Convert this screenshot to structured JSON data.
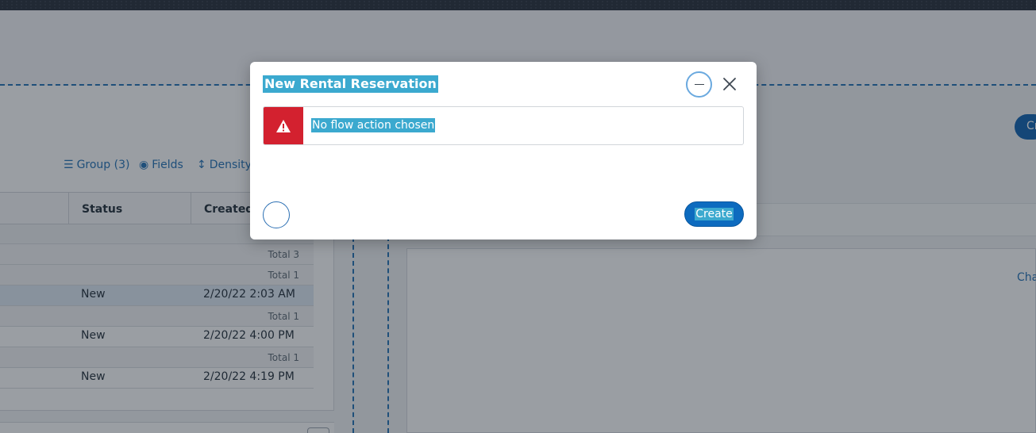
{
  "background": {
    "toolbar": {
      "group_label": "Group (3)",
      "fields_label": "Fields",
      "density_label": "Density"
    },
    "grid": {
      "headers": [
        "Status",
        "Created"
      ],
      "rows": [
        {
          "kind": "total",
          "label": "Total 3"
        },
        {
          "kind": "total",
          "label": "Total 1"
        },
        {
          "kind": "data",
          "status": "New",
          "created": "2/20/22 2:03 AM"
        },
        {
          "kind": "total",
          "label": "Total 1"
        },
        {
          "kind": "data",
          "status": "New",
          "created": "2/20/22 4:00 PM"
        },
        {
          "kind": "total",
          "label": "Total 1"
        },
        {
          "kind": "data",
          "status": "New",
          "created": "2/20/22 4:19 PM"
        }
      ]
    },
    "right_link_label": "Cha",
    "right_button_label": "Cr"
  },
  "modal": {
    "title": "New Rental Reservation",
    "alert_message": "No flow action chosen",
    "create_label": "Create"
  },
  "colors": {
    "accent": "#0d6bbf",
    "alert": "#d3212f",
    "selection_highlight": "#3ba9cf"
  }
}
